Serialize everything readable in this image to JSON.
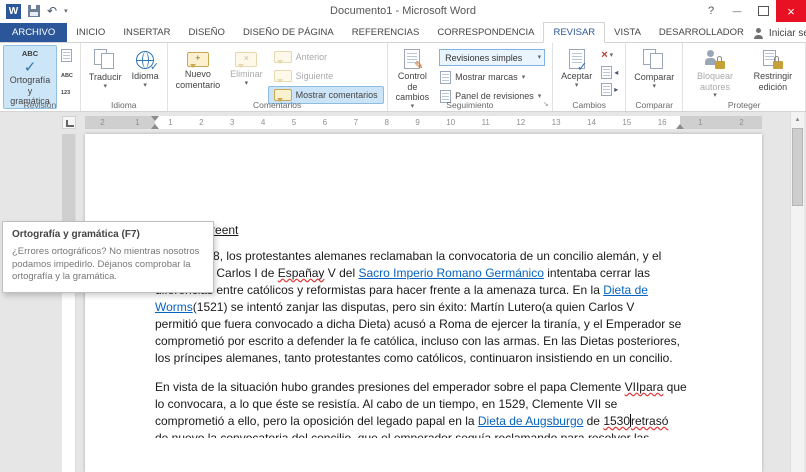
{
  "window": {
    "title": "Documento1 - Microsoft Word",
    "sign_in": "Iniciar sesión"
  },
  "tabs": [
    "ARCHIVO",
    "INICIO",
    "INSERTAR",
    "DISEÑO",
    "DISEÑO DE PÁGINA",
    "REFERENCIAS",
    "CORRESPONDENCIA",
    "REVISAR",
    "VISTA",
    "DESARROLLADOR"
  ],
  "ribbon": {
    "revision": {
      "label": "Revisión",
      "ortografia": "Ortografía y gramática"
    },
    "idioma": {
      "label": "Idioma",
      "traducir": "Traducir",
      "idioma": "Idioma"
    },
    "comentarios": {
      "label": "Comentarios",
      "nuevo": "Nuevo comentario",
      "eliminar": "Eliminar",
      "anterior": "Anterior",
      "siguiente": "Siguiente",
      "mostrar": "Mostrar comentarios"
    },
    "seguimiento": {
      "label": "Seguimiento",
      "control": "Control de cambios",
      "revisiones": "Revisiones simples",
      "marcas": "Mostrar marcas",
      "panel": "Panel de revisiones"
    },
    "cambios": {
      "label": "Cambios",
      "aceptar": "Aceptar"
    },
    "comparar": {
      "label": "Comparar",
      "comparar": "Comparar"
    },
    "proteger": {
      "label": "Proteger",
      "bloquear": "Bloquear autores",
      "restringir": "Restringir edición"
    }
  },
  "tooltip": {
    "title": "Ortografía y gramática (F7)",
    "body": "¿Errores ortográficos? No mientras nosotros podamos impedirlo. Déjanos comprobar la ortografía y la gramática."
  },
  "ruler": {
    "left": [
      "2",
      "1"
    ],
    "center": [
      "1",
      "2",
      "3",
      "4",
      "5",
      "6",
      "7",
      "8",
      "9",
      "10",
      "11",
      "12",
      "13",
      "14",
      "15",
      "16"
    ],
    "right": [
      "1",
      "2"
    ]
  },
  "document": {
    "heading": "Cocilio detreent",
    "paragraphs": [
      {
        "lines": [
          {
            "segs": [
              {
                "t": "Desde 1518, los protestantes alemanes reclamaban la convocatoria de un concilio alemán, y el"
              }
            ]
          },
          {
            "segs": [
              {
                "t": "emperador Carlos I de "
              },
              {
                "t": "Españay",
                "s": "sp"
              },
              {
                "t": " V del "
              },
              {
                "t": "Sacro Imperio Romano Germánico",
                "s": "link"
              },
              {
                "t": " intentaba cerrar las"
              }
            ]
          },
          {
            "segs": [
              {
                "t": "diferencias entre católicos y reformistas para hacer frente a la amenaza turca. En la "
              },
              {
                "t": "Dieta de",
                "s": "link"
              }
            ]
          },
          {
            "segs": [
              {
                "t": "Worms",
                "s": "link"
              },
              {
                "t": "(1521) se intentó zanjar las disputas, pero sin éxito: Martín Lutero(a quien Carlos V"
              }
            ]
          },
          {
            "segs": [
              {
                "t": "permitió que fuera convocado a dicha Dieta) acusó a Roma de ejercer la tiranía, y el Emperador se"
              }
            ]
          },
          {
            "segs": [
              {
                "t": "comprometió por escrito a defender la fe católica, incluso con las armas. En las Dietas posteriores,"
              }
            ]
          },
          {
            "segs": [
              {
                "t": "los príncipes alemanes, tanto protestantes como católicos, continuaron insistiendo en un concilio."
              }
            ]
          }
        ]
      },
      {
        "lines": [
          {
            "segs": [
              {
                "t": "En vista de la situación hubo grandes presiones del emperador sobre el papa Clemente "
              },
              {
                "t": "VIIpara",
                "s": "sp"
              },
              {
                "t": " que"
              }
            ]
          },
          {
            "segs": [
              {
                "t": "lo convocara, a lo que éste se resistía. Al cabo de un tiempo, en 1529, Clemente VII se"
              }
            ]
          },
          {
            "segs": [
              {
                "t": "comprometió a ello, pero la oposición del legado papal en la "
              },
              {
                "t": "Dieta de Augsburgo",
                "s": "link"
              },
              {
                "t": " de "
              },
              {
                "t": "1530",
                "s": "sp"
              },
              {
                "t": "",
                "s": "caret"
              },
              {
                "t": "retrasó",
                "s": "sp"
              }
            ]
          },
          {
            "clip": true,
            "segs": [
              {
                "t": "de nuevo la convocatoria del concilio, que el emperador seguía reclamando para resolver las"
              }
            ]
          }
        ]
      }
    ]
  }
}
